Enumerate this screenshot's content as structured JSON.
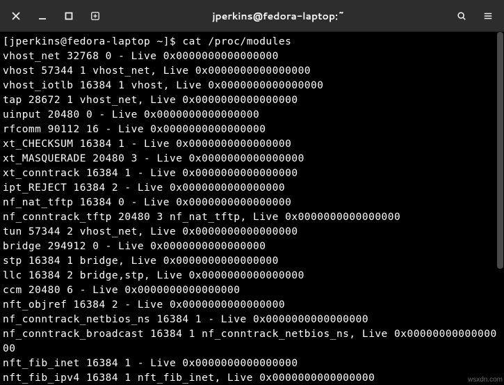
{
  "window": {
    "title": "jperkins@fedora-laptop:~"
  },
  "prompt": {
    "user_host": "[jperkins@fedora-laptop ~]$ ",
    "command": "cat /proc/modules"
  },
  "output_lines": [
    "vhost_net 32768 0 - Live 0x0000000000000000",
    "vhost 57344 1 vhost_net, Live 0x0000000000000000",
    "vhost_iotlb 16384 1 vhost, Live 0x0000000000000000",
    "tap 28672 1 vhost_net, Live 0x0000000000000000",
    "uinput 20480 0 - Live 0x0000000000000000",
    "rfcomm 90112 16 - Live 0x0000000000000000",
    "xt_CHECKSUM 16384 1 - Live 0x0000000000000000",
    "xt_MASQUERADE 20480 3 - Live 0x0000000000000000",
    "xt_conntrack 16384 1 - Live 0x0000000000000000",
    "ipt_REJECT 16384 2 - Live 0x0000000000000000",
    "nf_nat_tftp 16384 0 - Live 0x0000000000000000",
    "nf_conntrack_tftp 20480 3 nf_nat_tftp, Live 0x0000000000000000",
    "tun 57344 2 vhost_net, Live 0x0000000000000000",
    "bridge 294912 0 - Live 0x0000000000000000",
    "stp 16384 1 bridge, Live 0x0000000000000000",
    "llc 16384 2 bridge,stp, Live 0x0000000000000000",
    "ccm 20480 6 - Live 0x0000000000000000",
    "nft_objref 16384 2 - Live 0x0000000000000000",
    "nf_conntrack_netbios_ns 16384 1 - Live 0x0000000000000000",
    "nf_conntrack_broadcast 16384 1 nf_conntrack_netbios_ns, Live 0x0000000000000000",
    "nft_fib_inet 16384 1 - Live 0x0000000000000000",
    "nft_fib_ipv4 16384 1 nft_fib_inet, Live 0x0000000000000000"
  ],
  "watermark": "wsxdn.com"
}
